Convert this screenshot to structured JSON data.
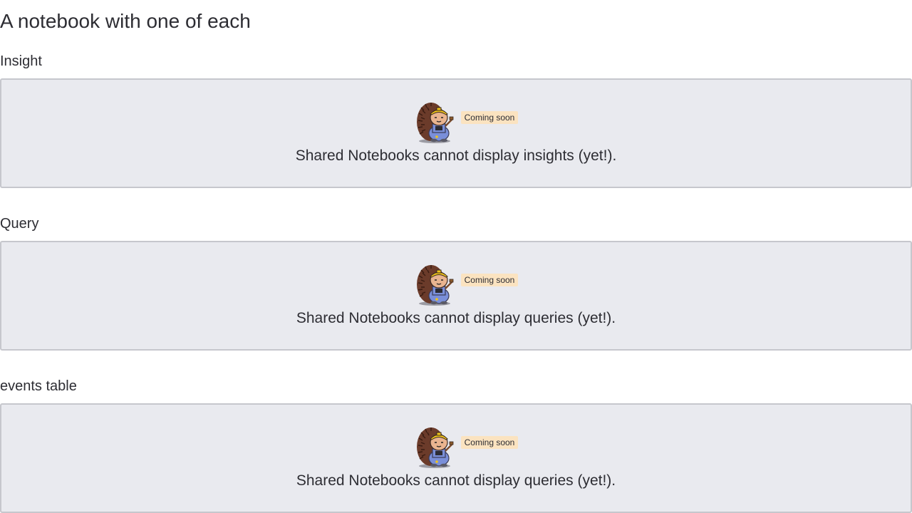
{
  "notebook": {
    "title": "A notebook with one of each"
  },
  "sections": [
    {
      "heading": "Insight",
      "badge": "Coming soon",
      "message": "Shared Notebooks cannot display insights (yet!).",
      "mascot_icon": "hedgehog-builder-icon"
    },
    {
      "heading": "Query",
      "badge": "Coming soon",
      "message": "Shared Notebooks cannot display queries (yet!).",
      "mascot_icon": "hedgehog-builder-icon"
    },
    {
      "heading": "events table",
      "badge": "Coming soon",
      "message": "Shared Notebooks cannot display queries (yet!).",
      "mascot_icon": "hedgehog-builder-icon"
    }
  ],
  "colors": {
    "card_background": "#e9eaef",
    "card_border": "#c6c7cd",
    "badge_background": "#fbe3c0",
    "text": "#2d2d33"
  }
}
